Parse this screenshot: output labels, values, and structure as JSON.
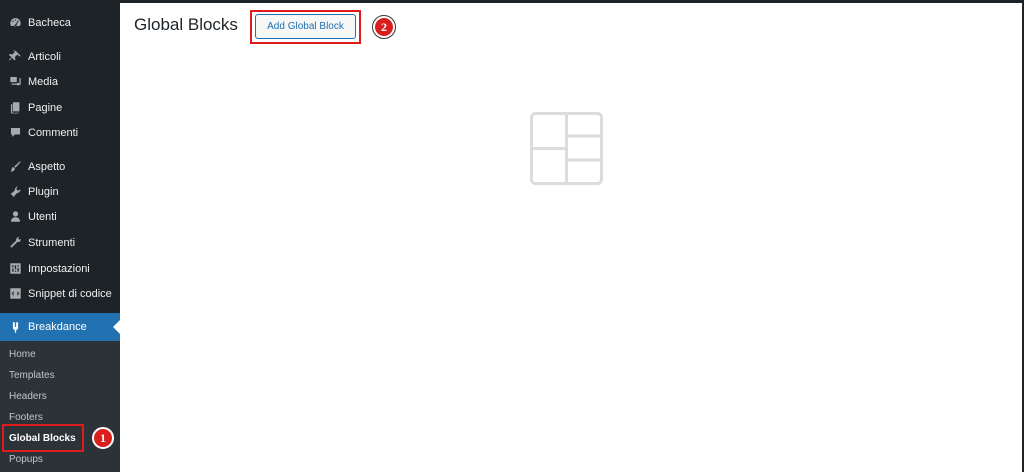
{
  "sidebar": {
    "items": [
      {
        "label": "Bacheca",
        "icon": "dashboard-icon"
      },
      {
        "label": "Articoli",
        "icon": "pin-icon"
      },
      {
        "label": "Media",
        "icon": "media-icon"
      },
      {
        "label": "Pagine",
        "icon": "pages-icon"
      },
      {
        "label": "Commenti",
        "icon": "comments-icon"
      },
      {
        "label": "Aspetto",
        "icon": "brush-icon"
      },
      {
        "label": "Plugin",
        "icon": "plugin-icon"
      },
      {
        "label": "Utenti",
        "icon": "users-icon"
      },
      {
        "label": "Strumenti",
        "icon": "wrench-icon"
      },
      {
        "label": "Impostazioni",
        "icon": "settings-icon"
      },
      {
        "label": "Snippet di codice",
        "icon": "code-snippet-icon"
      }
    ],
    "active": {
      "label": "Breakdance",
      "icon": "breakdance-icon"
    },
    "submenu": [
      {
        "label": "Home"
      },
      {
        "label": "Templates"
      },
      {
        "label": "Headers"
      },
      {
        "label": "Footers"
      },
      {
        "label": "Global Blocks"
      },
      {
        "label": "Popups"
      }
    ]
  },
  "main": {
    "title": "Global Blocks",
    "add_button": "Add Global Block",
    "empty_icon": "layout-blocks-icon"
  },
  "annotations": {
    "badge1": "1",
    "badge2": "2",
    "highlight_color": "#e01b1b"
  },
  "colors": {
    "sidebar_bg": "#1d2327",
    "submenu_bg": "#2c3338",
    "accent": "#2271b1"
  }
}
